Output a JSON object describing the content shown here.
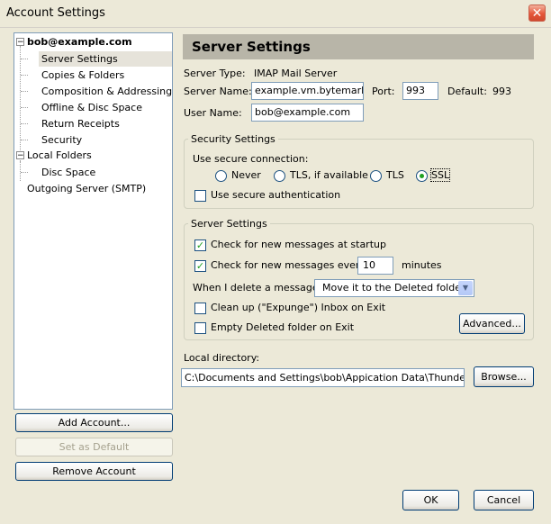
{
  "window": {
    "title": "Account Settings",
    "close_glyph": "✕"
  },
  "tree": {
    "account": "bob@example.com",
    "account_items": [
      "Server Settings",
      "Copies & Folders",
      "Composition & Addressing",
      "Offline & Disc Space",
      "Return Receipts",
      "Security"
    ],
    "local_folders": "Local Folders",
    "local_items": [
      "Disc Space"
    ],
    "outgoing": "Outgoing Server (SMTP)",
    "selected": "Server Settings"
  },
  "left_buttons": {
    "add": "Add Account...",
    "default": "Set as Default",
    "remove": "Remove Account"
  },
  "panel": {
    "title": "Server Settings",
    "server_type_label": "Server Type:",
    "server_type_value": "IMAP Mail Server",
    "server_name_label": "Server Name:",
    "server_name_value": "example.vm.bytemark.co",
    "port_label": "Port:",
    "port_value": "993",
    "default_label": "Default:",
    "default_value": "993",
    "user_name_label": "User Name:",
    "user_name_value": "bob@example.com"
  },
  "security": {
    "legend": "Security Settings",
    "use_secure_label": "Use secure connection:",
    "options": [
      "Never",
      "TLS, if available",
      "TLS",
      "SSL"
    ],
    "selected": "SSL",
    "secure_auth_label": "Use secure authentication",
    "secure_auth_checked": false
  },
  "server": {
    "legend": "Server Settings",
    "check_startup_label": "Check for new messages at startup",
    "check_startup_checked": true,
    "check_every_label": "Check for new messages every",
    "check_every_value": "10",
    "check_every_checked": true,
    "minutes_label": "minutes",
    "delete_label": "When I delete a message:",
    "delete_value": "Move it to the Deleted folder",
    "cleanup_label": "Clean up (\"Expunge\") Inbox on Exit",
    "empty_deleted_label": "Empty Deleted folder on Exit",
    "advanced_button": "Advanced..."
  },
  "local_dir": {
    "label": "Local directory:",
    "value": "C:\\Documents and Settings\\bob\\Appication Data\\Thunderbird\\p",
    "browse_button": "Browse..."
  },
  "dialog_buttons": {
    "ok": "OK",
    "cancel": "Cancel"
  },
  "glyphs": {
    "check": "✓",
    "minus": "−",
    "arrow": "▼"
  }
}
